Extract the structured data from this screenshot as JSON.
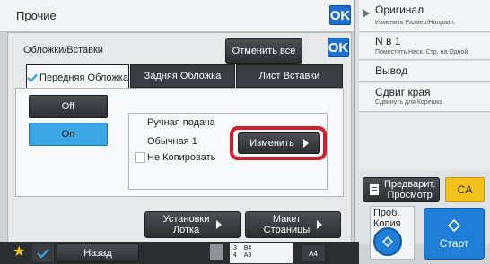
{
  "top": {
    "title": "Прочие",
    "ok_label": "OK"
  },
  "dialog": {
    "title": "Обложки/Вставки",
    "cancel_all_label": "Отменить все",
    "ok_label": "OK",
    "tabs": [
      {
        "label": "Передняя Обложка",
        "active": true
      },
      {
        "label": "Задняя Обложка",
        "active": false
      },
      {
        "label": "Лист Вставки",
        "active": false
      }
    ],
    "off_label": "Off",
    "on_label": "On",
    "options": {
      "feed": "Ручная подача",
      "paper": "Обычная 1",
      "copy": "Не Копировать"
    },
    "change_label": "Изменить",
    "tray_settings_label_1": "Установки",
    "tray_settings_label_2": "Лотка",
    "page_layout_label_1": "Макет",
    "page_layout_label_2": "Страницы"
  },
  "right_panel": {
    "original_title": "Оригинал",
    "original_sub": "Изменить Размер/Направл.",
    "n_in_1_title": "N в 1",
    "n_in_1_sub": "Поместить Неск. Стр. на Одной",
    "output_title": "Вывод",
    "margin_title": "Сдвиг края",
    "margin_sub": "Сдвинуть для Корешка",
    "preview_label_1": "Предварит.",
    "preview_label_2": "Просмотр",
    "ca_label": "CA",
    "proof_label_1": "Проб.",
    "proof_label_2": "Копия",
    "start_label": "Старт"
  },
  "bottom_bar": {
    "back_label": "Назад",
    "tray_3": "3",
    "tray_3_size": "B4",
    "tray_4": "4",
    "tray_4_size": "A3",
    "paper_size": "A4"
  },
  "colors": {
    "accent_blue": "#1f6fd1",
    "on_blue": "#3ba7e4",
    "highlight_red": "#d0202e",
    "ca_yellow": "#f2c21b"
  }
}
